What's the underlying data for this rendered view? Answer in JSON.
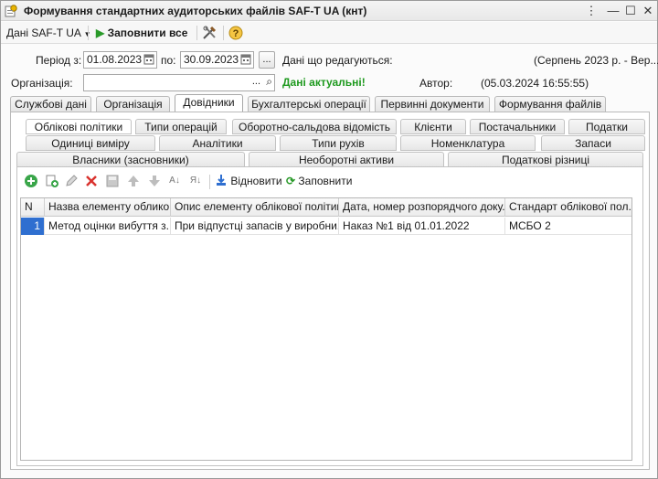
{
  "window": {
    "title": "Формування стандартних аудиторських файлів SAF-T UA (кнт)"
  },
  "toolbar": {
    "data_menu": "Дані SAF-T UA",
    "fill_all": "Заповнити все"
  },
  "form": {
    "period_label": "Період з:",
    "date_from": "01.08.2023",
    "to_label": "по:",
    "date_to": "30.09.2023",
    "ellipsis": "...",
    "editing_label": "Дані що редагуються:",
    "editing_value": "(Серпень 2023 р. - Вер...",
    "org_label": "Організація:",
    "org_value": "",
    "status": "Дані актуальні!",
    "author_label": "Автор:",
    "author_value": "(05.03.2024 16:55:55)"
  },
  "main_tabs": [
    "Службові дані",
    "Організація",
    "Довідники",
    "Бухгалтерські операції",
    "Первинні документи",
    "Формування файлів"
  ],
  "sub_tabs_row1": [
    "Облікові політики",
    "Типи операцій",
    "Оборотно-сальдова відомість",
    "Клієнти",
    "Постачальники",
    "Податки"
  ],
  "sub_tabs_row2": [
    "Одиниці виміру",
    "Аналітики",
    "Типи рухів",
    "Номенклатура",
    "Запаси"
  ],
  "sub_tabs_row3": [
    "Власники (засновники)",
    "Необоротні активи",
    "Податкові різниці"
  ],
  "sub_toolbar": {
    "restore": "Відновити",
    "fill": "Заповнити"
  },
  "table": {
    "columns": [
      "N",
      "Назва елементу облико...",
      "Опис елементу облікової політики",
      "Дата, номер розпорядчого доку...",
      "Стандарт облікової пол..."
    ],
    "rows": [
      {
        "n": "1",
        "name": "Метод оцінки вибуття з...",
        "desc": "При відпустці запасів у виробни...",
        "doc": "Наказ №1 від 01.01.2022",
        "standard": "МСБО 2"
      }
    ]
  },
  "colors": {
    "status_green": "#1f9a1f",
    "selection": "#2f6fd0"
  }
}
